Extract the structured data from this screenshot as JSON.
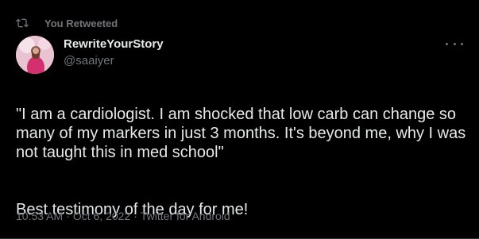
{
  "retweet": {
    "label": "You Retweeted",
    "icon": "retweet-icon"
  },
  "author": {
    "display_name": "RewriteYourStory",
    "handle": "@saaiyer",
    "avatar": "profile-avatar"
  },
  "menu": {
    "icon": "more-options-icon"
  },
  "tweet": {
    "paragraph_1": "\"I am a cardiologist. I am shocked that low carb can change so many of my markers in just 3 months. It's beyond me, why I was not taught this in med school\"",
    "paragraph_2": "Best testimony of the day for me!"
  },
  "meta": {
    "time": "10:53 AM",
    "date": "Oct 6, 2022",
    "source": "Twitter for Android",
    "separator": "·"
  },
  "colors": {
    "background": "#000000",
    "text_primary": "#e7e9ea",
    "text_secondary": "#71767b"
  }
}
